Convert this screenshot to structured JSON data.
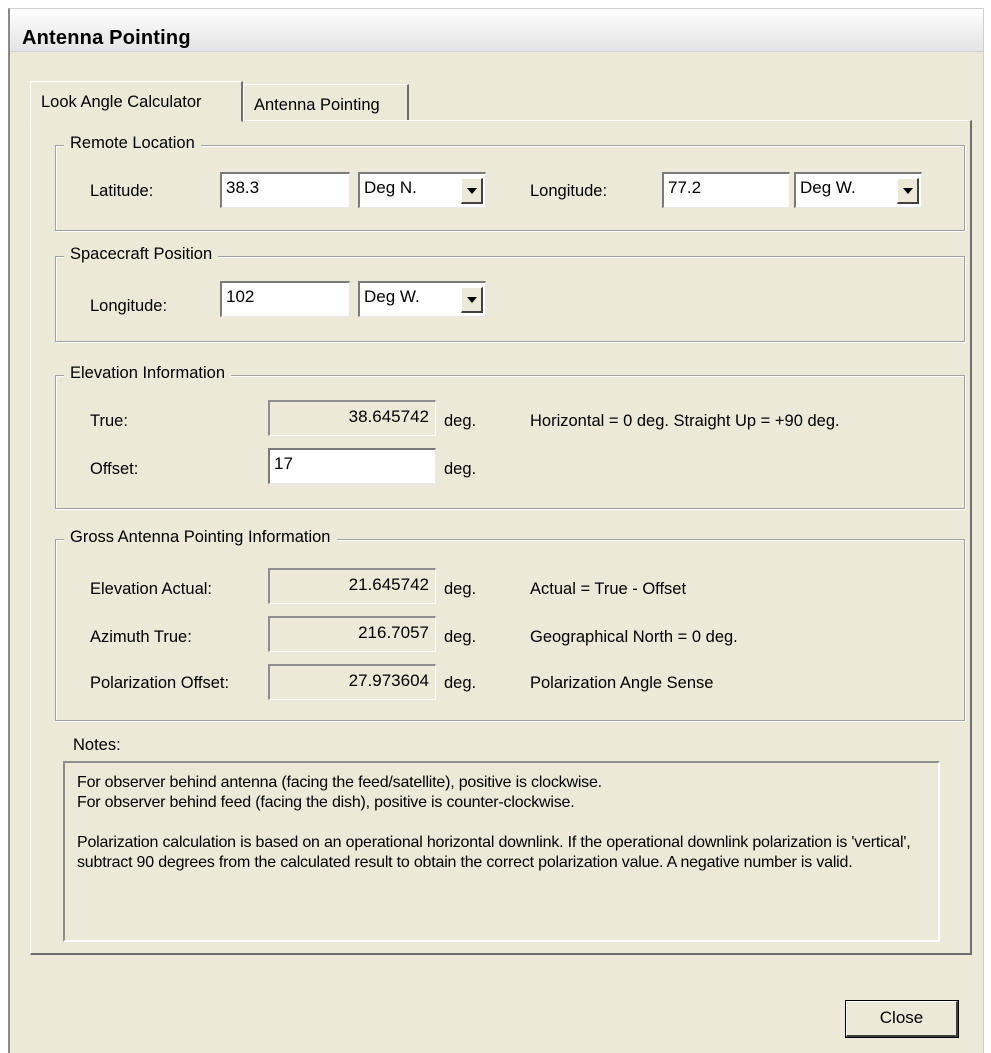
{
  "window": {
    "title": "Antenna Pointing"
  },
  "tabs": [
    {
      "label": "Look Angle Calculator",
      "active": true
    },
    {
      "label": "Antenna Pointing",
      "active": false
    }
  ],
  "remote_location": {
    "legend": "Remote Location",
    "latitude_label": "Latitude:",
    "latitude_value": "38.3",
    "latitude_unit": "Deg N.",
    "longitude_label": "Longitude:",
    "longitude_value": "77.2",
    "longitude_unit": "Deg W."
  },
  "spacecraft_position": {
    "legend": "Spacecraft Position",
    "longitude_label": "Longitude:",
    "longitude_value": "102",
    "longitude_unit": "Deg W."
  },
  "elevation_info": {
    "legend": "Elevation Information",
    "true_label": "True:",
    "true_value": "38.645742",
    "true_unit": "deg.",
    "true_note": "Horizontal = 0 deg.  Straight Up = +90 deg.",
    "offset_label": "Offset:",
    "offset_value": "17",
    "offset_unit": "deg."
  },
  "gross_pointing": {
    "legend": "Gross Antenna Pointing Information",
    "rows": [
      {
        "label": "Elevation Actual:",
        "value": "21.645742",
        "unit": "deg.",
        "note": "Actual = True - Offset"
      },
      {
        "label": "Azimuth True:",
        "value": "216.7057",
        "unit": "deg.",
        "note": "Geographical North = 0 deg."
      },
      {
        "label": "Polarization Offset:",
        "value": "27.973604",
        "unit": "deg.",
        "note": "Polarization Angle Sense"
      }
    ]
  },
  "notes": {
    "label": "Notes:",
    "lines": [
      "For observer behind antenna (facing the feed/satellite), positive is clockwise.",
      "For observer behind feed (facing the dish), positive is counter-clockwise.",
      "Polarization calculation is based on an operational horizontal downlink. If the operational downlink polarization is 'vertical', subtract 90 degrees from the calculated result to obtain the correct polarization value. A negative number is valid."
    ]
  },
  "buttons": {
    "close": "Close"
  },
  "icons": {
    "dropdown": "chevron-down-icon"
  }
}
